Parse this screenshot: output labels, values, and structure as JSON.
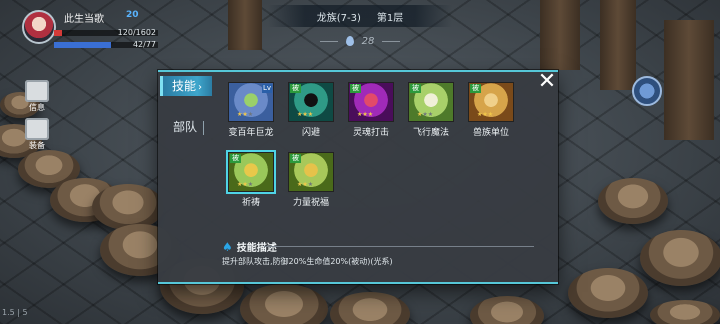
{
  "player": {
    "name": "此生当歌",
    "level": "20",
    "hp_text": "120/1602",
    "hp_fraction": 0.075,
    "mp_text": "42/77",
    "mp_fraction": 0.55
  },
  "stage": {
    "name": "龙族(7-3)",
    "floor": "第1层",
    "steps": "28"
  },
  "side_buttons": [
    {
      "label": "信息",
      "icon": "info-icon"
    },
    {
      "label": "装备",
      "icon": "equipment-icon"
    }
  ],
  "version": "1.5 | 5",
  "dialog": {
    "tabs": [
      {
        "label": "技能",
        "active": true
      },
      {
        "label": "部队",
        "active": false
      }
    ],
    "skills": [
      {
        "label": "变百年巨龙",
        "badge": "",
        "level": "Lv",
        "stars": 2,
        "icon": "dragon-icon",
        "colors": [
          "#6a8ac8",
          "#3b5f9e",
          "#9ad06a"
        ]
      },
      {
        "label": "闪避",
        "badge": "被",
        "level": "",
        "stars": 3,
        "icon": "black-cat-icon",
        "colors": [
          "#2f9a86",
          "#0f4a44",
          "#111"
        ]
      },
      {
        "label": "灵魂打击",
        "badge": "被",
        "level": "",
        "stars": 3,
        "icon": "soul-strike-icon",
        "colors": [
          "#a02ab8",
          "#4a0d5a",
          "#e24a6a"
        ]
      },
      {
        "label": "飞行魔法",
        "badge": "被",
        "level": "",
        "stars": 1,
        "icon": "feather-icon",
        "colors": [
          "#a8d06a",
          "#4e7a2a",
          "#f0f0d8"
        ]
      },
      {
        "label": "兽族单位",
        "badge": "被",
        "level": "",
        "stars": 3,
        "icon": "beast-icon",
        "colors": [
          "#d6a44a",
          "#7a4a1a",
          "#f0d08a"
        ]
      },
      {
        "label": "祈祷",
        "badge": "被",
        "level": "",
        "stars": 2,
        "icon": "winged-shield-icon",
        "colors": [
          "#9ac85a",
          "#4a6a1a",
          "#e8c84a"
        ],
        "selected": true
      },
      {
        "label": "力量祝福",
        "badge": "被",
        "level": "",
        "stars": 2,
        "icon": "heart-hand-icon",
        "colors": [
          "#a8c85a",
          "#4a6a1a",
          "#e6c24a"
        ]
      }
    ],
    "description": {
      "title": "技能描述",
      "text": "提升部队攻击,防御20%生命值20%(被动)(光系)"
    }
  }
}
